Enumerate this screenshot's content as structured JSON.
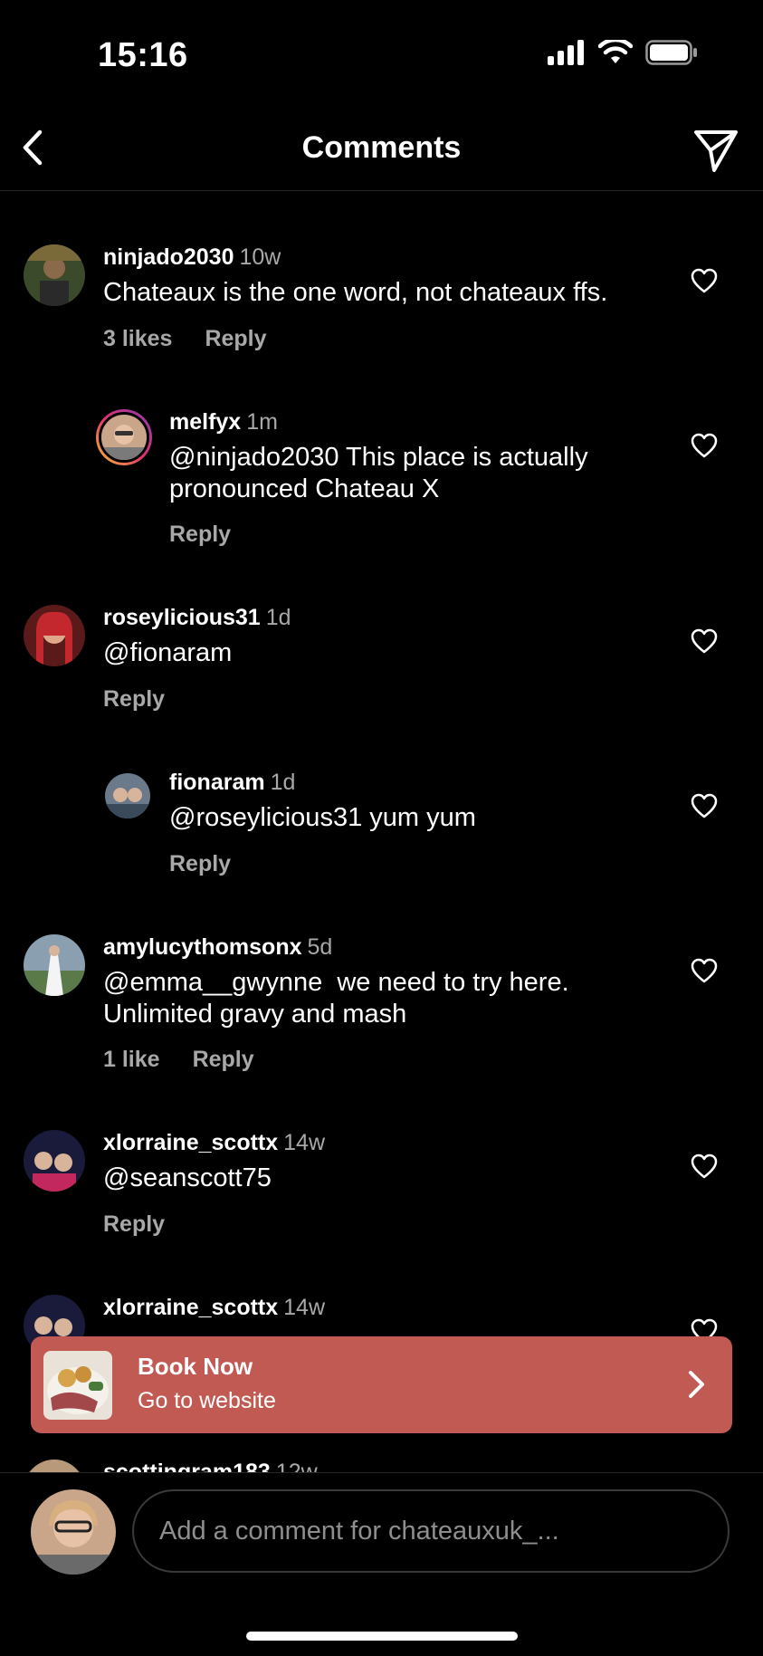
{
  "status": {
    "time": "15:16",
    "icons": [
      "cellular-signal-icon",
      "wifi-icon",
      "battery-icon"
    ]
  },
  "header": {
    "title": "Comments",
    "back_icon": "chevron-left-icon",
    "share_icon": "paper-plane-icon"
  },
  "comments": [
    {
      "username": "ninjado2030",
      "time": "10w",
      "text": "Chateaux is the one word, not chateaux ffs.",
      "likes": "3 likes",
      "reply": "Reply"
    },
    {
      "username": "melfyx",
      "time": "1m",
      "text": "@ninjado2030 This place is actually\npronounced Chateau X",
      "reply": "Reply"
    },
    {
      "username": "roseylicious31",
      "time": "1d",
      "text": "@fionaram",
      "reply": "Reply"
    },
    {
      "username": "fionaram",
      "time": "1d",
      "text": "@roseylicious31 yum yum",
      "reply": "Reply"
    },
    {
      "username": "amylucythomsonx",
      "time": "5d",
      "text": "@emma__gwynne  we need to try here.\nUnlimited gravy and mash",
      "likes": "1 like",
      "reply": "Reply"
    },
    {
      "username": "xlorraine_scottx",
      "time": "14w",
      "text": "@seanscott75",
      "reply": "Reply"
    },
    {
      "username": "xlorraine_scottx",
      "time": "14w"
    },
    {
      "username": "scottingram183",
      "time": "12w"
    }
  ],
  "banner": {
    "title": "Book Now",
    "subtitle": "Go to website"
  },
  "composer": {
    "placeholder": "Add a comment for chateauxuk_..."
  },
  "colors": {
    "background": "#000000",
    "banner": "#c25a54",
    "muted": "#a8a8a8"
  }
}
